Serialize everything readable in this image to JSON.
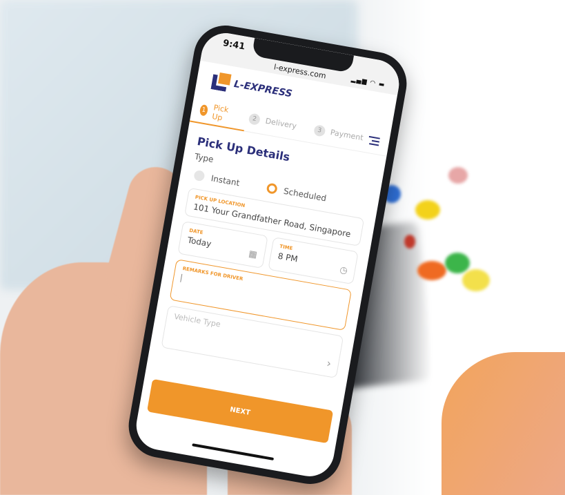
{
  "status": {
    "time": "9:41",
    "url": "l-express.com",
    "icons": "signal wifi battery"
  },
  "brand": {
    "name": "L-EXPRESS",
    "primary": "#2b2f7a",
    "accent": "#f0962a"
  },
  "tabs": [
    {
      "num": "1",
      "label": "Pick Up",
      "active": true
    },
    {
      "num": "2",
      "label": "Delivery"
    },
    {
      "num": "3",
      "label": "Payment"
    }
  ],
  "form": {
    "title": "Pick Up Details",
    "type_label": "Type",
    "type_options": [
      {
        "label": "Instant",
        "selected": false
      },
      {
        "label": "Scheduled",
        "selected": true
      }
    ],
    "location": {
      "label": "PICK UP LOCATION",
      "value": "101 Your Grandfather Road, Singapore"
    },
    "date": {
      "label": "DATE",
      "value": "Today",
      "icon": "calendar-icon"
    },
    "time": {
      "label": "TIME",
      "value": "8 PM",
      "icon": "clock-icon"
    },
    "remarks": {
      "label": "REMARKS FOR DRIVER",
      "value": ""
    },
    "vehicle": {
      "placeholder": "Vehicle Type",
      "icon": "chevron-right-icon"
    },
    "next_label": "NEXT"
  }
}
